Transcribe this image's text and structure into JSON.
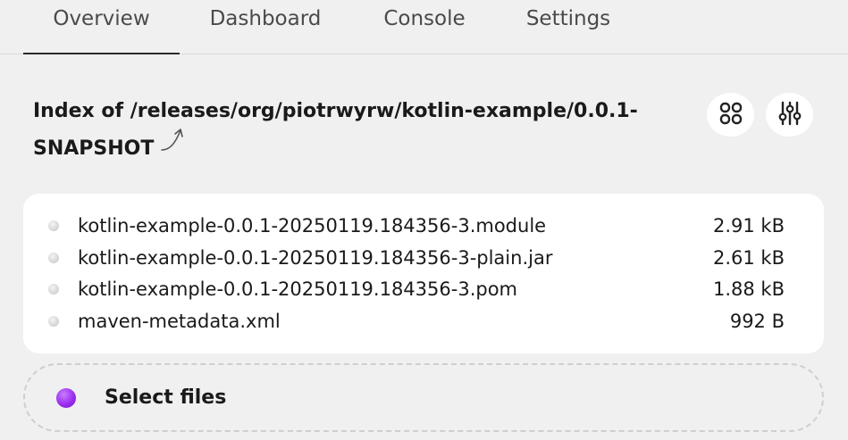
{
  "tabs": [
    {
      "label": "Overview",
      "active": true
    },
    {
      "label": "Dashboard",
      "active": false
    },
    {
      "label": "Console",
      "active": false
    },
    {
      "label": "Settings",
      "active": false
    }
  ],
  "header": {
    "title": "Index of /releases/org/piotrwyrw/kotlin-example/0.0.1-SNAPSHOT",
    "up_icon": "arrow-up-icon",
    "actions": [
      {
        "icon": "grid-view-icon"
      },
      {
        "icon": "sliders-icon"
      }
    ]
  },
  "files": [
    {
      "name": "kotlin-example-0.0.1-20250119.184356-3.module",
      "size": "2.91 kB"
    },
    {
      "name": "kotlin-example-0.0.1-20250119.184356-3-plain.jar",
      "size": "2.61 kB"
    },
    {
      "name": "kotlin-example-0.0.1-20250119.184356-3.pom",
      "size": "1.88 kB"
    },
    {
      "name": "maven-metadata.xml",
      "size": "992 B"
    }
  ],
  "upload": {
    "label": "Select files",
    "accent": "#9b2df0"
  },
  "colors": {
    "background": "#f0f0f0",
    "panel": "#ffffff",
    "active_tab_underline": "#2b2b2b"
  }
}
